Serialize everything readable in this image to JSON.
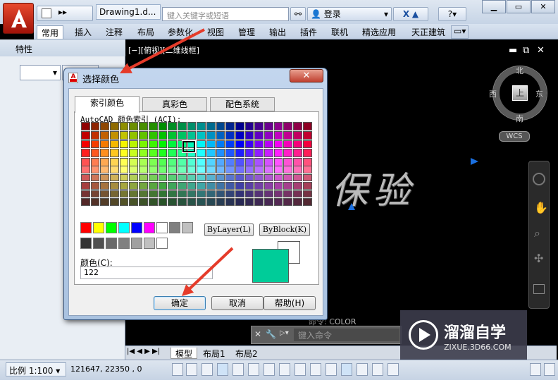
{
  "app": {
    "doc_title": "Drawing1.d...",
    "search_placeholder": "键入关键字或短语",
    "login": "登录",
    "ribbon_tabs": [
      "常用",
      "插入",
      "注释",
      "布局",
      "参数化",
      "视图",
      "管理",
      "输出",
      "插件",
      "联机",
      "精选应用",
      "天正建筑"
    ]
  },
  "left_panel": {
    "title": "特性"
  },
  "viewport": {
    "label": "[−][俯视][二维线框]",
    "compass": {
      "north": "北",
      "south": "南",
      "east": "东",
      "west": "西",
      "top": "上"
    },
    "wcs": "WCS",
    "canvas_text": "保验"
  },
  "command": {
    "hint": "命令: COLOR",
    "placeholder": "键入命令"
  },
  "layout_tabs": [
    "模型",
    "布局1",
    "布局2"
  ],
  "status": {
    "scale": "比例 1:100",
    "coords": "121647, 22350 , 0"
  },
  "watermark": {
    "brand": "溜溜自学",
    "url": "ZIXUE.3D66.COM"
  },
  "dialog": {
    "title": "选择颜色",
    "tabs": [
      "索引颜色",
      "真彩色",
      "配色系统"
    ],
    "aci_label": "AutoCAD 颜色索引 (ACI):",
    "bylayer": "ByLayer(L)",
    "byblock": "ByBlock(K)",
    "color_label": "颜色(C):",
    "color_value": "122",
    "ok": "确定",
    "cancel": "取消",
    "help": "帮助(H)",
    "preview_color": "#00cc99",
    "standard_colors": [
      "#ff0000",
      "#ffff00",
      "#00ff00",
      "#00ffff",
      "#0000ff",
      "#ff00ff",
      "#ffffff",
      "#808080",
      "#c0c0c0"
    ],
    "gray_colors": [
      "#333333",
      "#505050",
      "#696969",
      "#808080",
      "#a0a0a0",
      "#c0c0c0",
      "#ffffff"
    ]
  },
  "colors": {
    "arrow": "#e53b2a",
    "accent": "#1a6fe0"
  }
}
